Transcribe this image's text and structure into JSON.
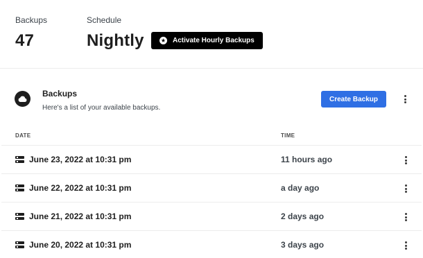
{
  "stats": {
    "backups_label": "Backups",
    "backups_value": "47",
    "schedule_label": "Schedule",
    "schedule_value": "Nightly",
    "hourly_button": "Activate Hourly Backups"
  },
  "section": {
    "title": "Backups",
    "subtitle": "Here's a list of your available backups.",
    "create_button": "Create Backup"
  },
  "table": {
    "columns": [
      "DATE",
      "TIME"
    ],
    "rows": [
      {
        "date": "June 23, 2022 at 10:31 pm",
        "ago": "11 hours ago"
      },
      {
        "date": "June 22, 2022 at 10:31 pm",
        "ago": "a day ago"
      },
      {
        "date": "June 21, 2022 at 10:31 pm",
        "ago": "2 days ago"
      },
      {
        "date": "June 20, 2022 at 10:31 pm",
        "ago": "3 days ago"
      }
    ]
  },
  "icons": {
    "header": "cloud-icon",
    "row": "server-icon",
    "menu": "more-vertical-icon",
    "hourly": "star-icon"
  },
  "colors": {
    "primary": "#2f6fe4",
    "dark": "#000000",
    "border": "#ececec"
  }
}
